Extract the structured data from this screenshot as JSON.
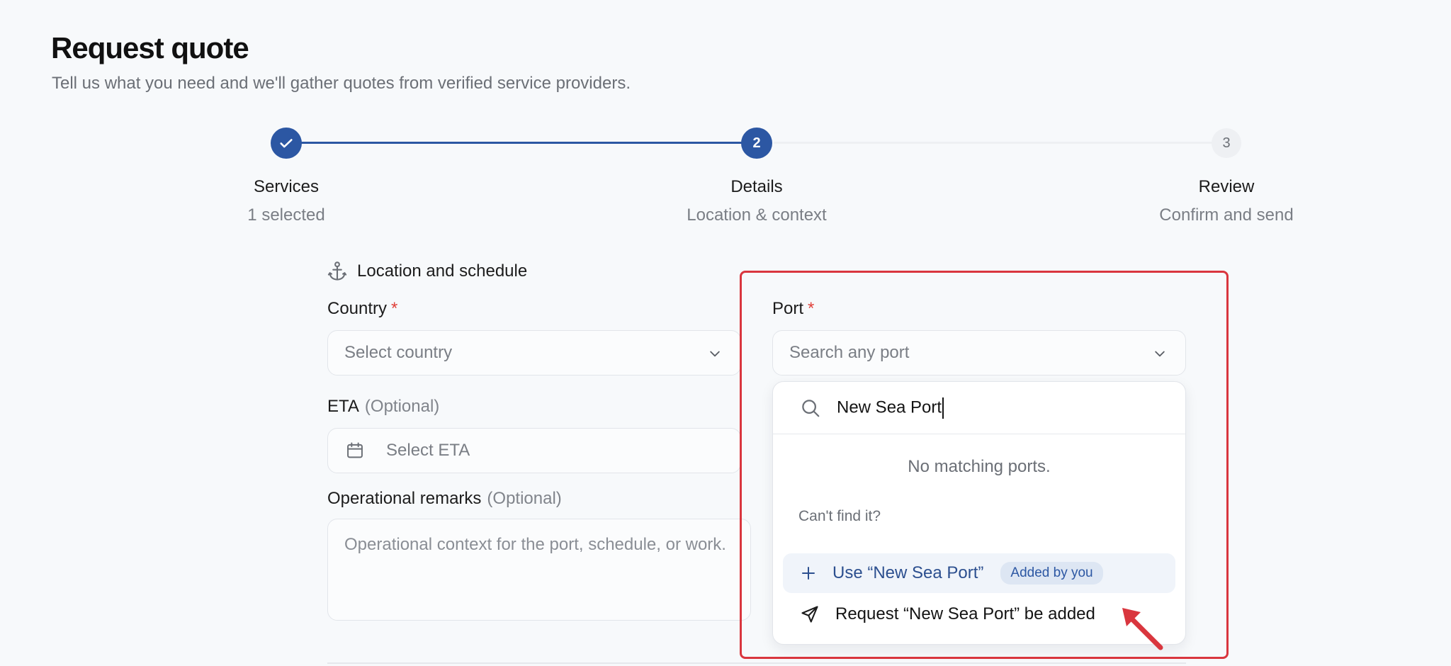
{
  "header": {
    "title": "Request quote",
    "subtitle": "Tell us what you need and we'll gather quotes from verified service providers."
  },
  "stepper": {
    "steps": [
      {
        "number": "1",
        "title": "Services",
        "subtitle": "1 selected",
        "state": "complete"
      },
      {
        "number": "2",
        "title": "Details",
        "subtitle": "Location & context",
        "state": "active"
      },
      {
        "number": "3",
        "title": "Review",
        "subtitle": "Confirm and send",
        "state": "pending"
      }
    ]
  },
  "form": {
    "section_title": "Location and schedule",
    "country": {
      "label": "Country",
      "required_mark": "*",
      "placeholder": "Select country"
    },
    "port": {
      "label": "Port",
      "required_mark": "*",
      "placeholder": "Search any port"
    },
    "eta": {
      "label": "ETA",
      "optional": "(Optional)",
      "placeholder": "Select ETA"
    },
    "remarks": {
      "label": "Operational remarks",
      "optional": "(Optional)",
      "placeholder": "Operational context for the port, schedule, or work."
    }
  },
  "port_dropdown": {
    "search_value": "New Sea Port",
    "empty_message": "No matching ports.",
    "cant_find_label": "Can't find it?",
    "use_option": "Use “New Sea Port”",
    "use_badge": "Added by you",
    "request_option": "Request “New Sea Port” be added"
  },
  "colors": {
    "accent": "#2c57a3",
    "required": "#e0413a",
    "highlight": "#d9363e"
  },
  "icons": [
    "check-icon",
    "anchor-icon",
    "chevron-down-icon",
    "calendar-icon",
    "search-icon",
    "plus-icon",
    "send-icon",
    "arrow-annotation-icon"
  ]
}
